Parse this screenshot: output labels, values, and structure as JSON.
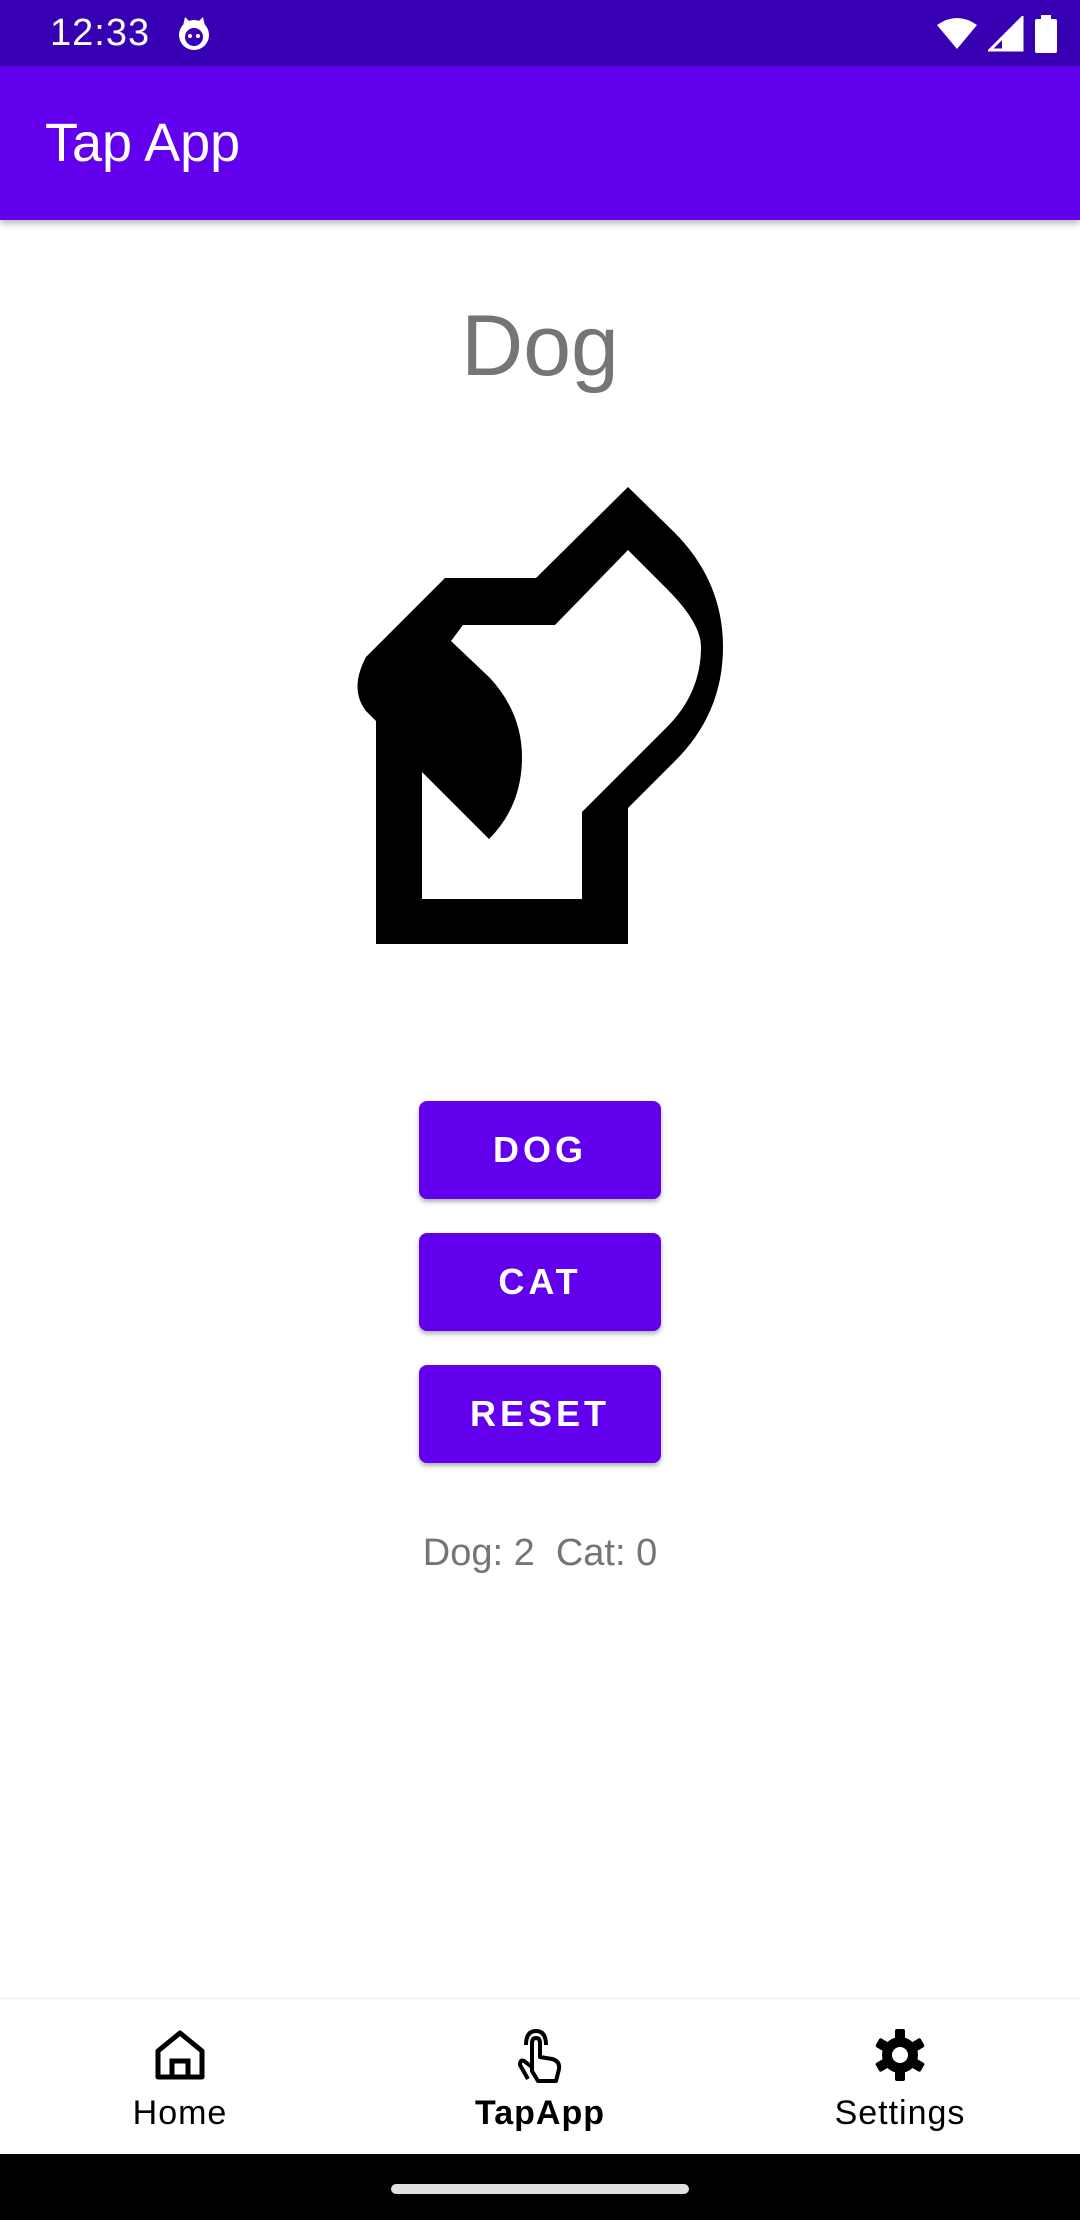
{
  "status_bar": {
    "time": "12:33",
    "icons": [
      "app-notification-icon",
      "wifi-icon",
      "signal-icon",
      "battery-icon"
    ]
  },
  "app_bar": {
    "title": "Tap App"
  },
  "main": {
    "animal_label": "Dog",
    "animal_image_icon": "dog-icon",
    "buttons": {
      "dog": "DOG",
      "cat": "CAT",
      "reset": "RESET"
    },
    "counter_text": "Dog: 2  Cat: 0"
  },
  "bottom_nav": {
    "items": [
      {
        "label": "Home",
        "icon": "home-icon",
        "active": false
      },
      {
        "label": "TapApp",
        "icon": "tap-icon",
        "active": true
      },
      {
        "label": "Settings",
        "icon": "gear-icon",
        "active": false
      }
    ]
  },
  "colors": {
    "primary": "#6200ee",
    "primary_dark": "#3700b3",
    "secondary_text": "#757575"
  }
}
